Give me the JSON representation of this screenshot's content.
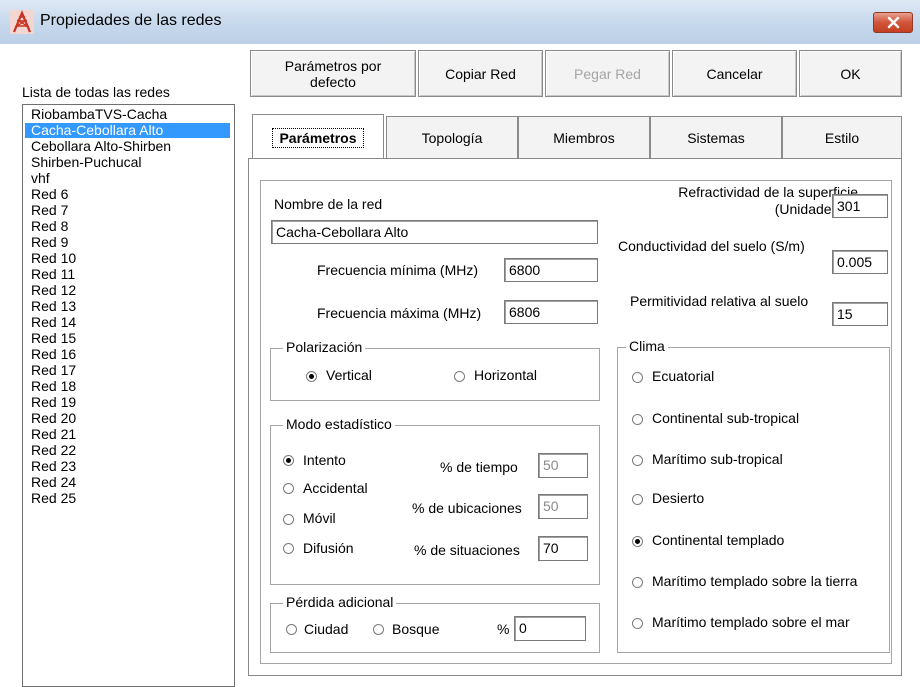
{
  "window": {
    "title": "Propiedades de las redes",
    "close_glyph": "×",
    "icon": "network-tower-icon"
  },
  "list": {
    "label": "Lista de todas las redes",
    "items": [
      "RiobambaTVS-Cacha",
      "Cacha-Cebollara Alto",
      "Cebollara Alto-Shirben",
      "Shirben-Puchucal",
      "vhf",
      "Red 6",
      "Red 7",
      "Red 8",
      "Red 9",
      "Red 10",
      "Red 11",
      "Red 12",
      "Red 13",
      "Red 14",
      "Red 15",
      "Red 16",
      "Red 17",
      "Red 18",
      "Red 19",
      "Red 20",
      "Red 21",
      "Red 22",
      "Red 23",
      "Red 24",
      "Red 25"
    ],
    "selected_index": 1
  },
  "toolbar": {
    "default_params_line1": "Parámetros por",
    "default_params_line2": "defecto",
    "copy": "Copiar Red",
    "paste": "Pegar Red",
    "cancel": "Cancelar",
    "ok": "OK"
  },
  "tabs": [
    "Parámetros",
    "Topología",
    "Miembros",
    "Sistemas",
    "Estilo"
  ],
  "params": {
    "network_name_label": "Nombre de la red",
    "network_name": "Cacha-Cebollara Alto",
    "min_freq_label": "Frecuencia mínima (MHz)",
    "min_freq": "6800",
    "max_freq_label": "Frecuencia máxima (MHz)",
    "max_freq": "6806",
    "refractivity_label_1": "Refractividad de la superficie",
    "refractivity_label_2": "(Unidades-N)",
    "refractivity": "301",
    "conductivity_label": "Conductividad del suelo (S/m)",
    "conductivity": "0.005",
    "permittivity_label": "Permitividad relativa al suelo",
    "permittivity": "15"
  },
  "polarization": {
    "legend": "Polarización",
    "vertical": "Vertical",
    "horizontal": "Horizontal",
    "selected": "vertical"
  },
  "statistical": {
    "legend": "Modo estadístico",
    "options": [
      "Intento",
      "Accidental",
      "Móvil",
      "Difusión"
    ],
    "selected_index": 0,
    "time_label": "% de tiempo",
    "time": "50",
    "location_label": "% de ubicaciones",
    "location": "50",
    "situations_label": "% de situaciones",
    "situations": "70"
  },
  "loss": {
    "legend": "Pérdida adicional",
    "city": "Ciudad",
    "forest": "Bosque",
    "percent_label": "%",
    "percent": "0"
  },
  "climate": {
    "legend": "Clima",
    "options": [
      "Ecuatorial",
      "Continental sub-tropical",
      "Marítimo sub-tropical",
      "Desierto",
      "Continental templado",
      "Marítimo templado sobre la tierra",
      "Marítimo templado sobre el mar"
    ],
    "selected_index": 4
  }
}
